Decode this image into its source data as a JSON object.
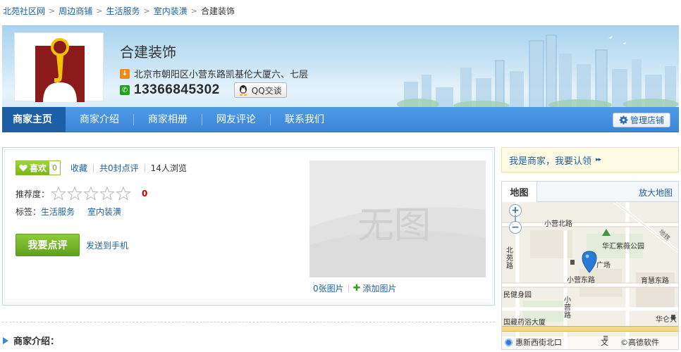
{
  "breadcrumb": [
    {
      "label": "北苑社区网"
    },
    {
      "label": "周边商铺"
    },
    {
      "label": "生活服务"
    },
    {
      "label": "室内装潢"
    },
    {
      "label": "合建装饰"
    }
  ],
  "breadcrumb_separator": ">",
  "shop": {
    "name": "合建装饰",
    "address": "北京市朝阳区小营东路凯基伦大厦六、七层",
    "phone": "13366845302",
    "qq_button": "QQ交谈"
  },
  "nav": {
    "tabs": [
      {
        "label": "商家主页",
        "active": true
      },
      {
        "label": "商家介绍",
        "active": false
      },
      {
        "label": "商家相册",
        "active": false
      },
      {
        "label": "网友评论",
        "active": false
      },
      {
        "label": "联系我们",
        "active": false
      }
    ],
    "manage_button": "管理店铺"
  },
  "info": {
    "like_label": "喜欢",
    "like_count": "0",
    "favorite": "收藏",
    "reviews": "共0封点评",
    "views": "14人浏览",
    "rating_label": "推荐度：",
    "rating_value": "0",
    "rating_stars": 0,
    "rating_max": 5,
    "tags_label": "标签：",
    "tags": [
      "生活服务",
      "室内装潢"
    ],
    "review_button": "我要点评",
    "send_to_phone": "发送到手机",
    "photo_placeholder": "无图",
    "photo_count": "0张图片",
    "add_photo": "添加图片"
  },
  "intro": {
    "title": "商家介绍："
  },
  "sidebar": {
    "claim_text": "我是商家，我要认领",
    "claim_arrows": "▸▸"
  },
  "map": {
    "tab": "地图",
    "enlarge": "放大地图",
    "zoom_in": "+",
    "zoom_out": "−",
    "labels": {
      "xiaoying_north": "小营北路",
      "huahui": "华汇紫薇公园",
      "beiyuan_road": "北苑路",
      "square": "广场",
      "xiaoying_east": "小营东路",
      "yuhui_east": "育慧东路",
      "minwang": "民健身园",
      "xiaoying_road": "小营路",
      "guocang": "国藏药浴大厦",
      "huaqi": "华仑大",
      "huixin": "惠新西街北口",
      "wenwei": "文",
      "gaode": "©高德软件",
      "didi": "地铁"
    }
  },
  "colors": {
    "nav_blue": "#3b86d6",
    "nav_active": "#1c5fa6",
    "link_blue": "#1f5f9e",
    "green_button": "#6aae22",
    "rating_red": "#cc0000",
    "claim_bg": "#fffbe4"
  }
}
